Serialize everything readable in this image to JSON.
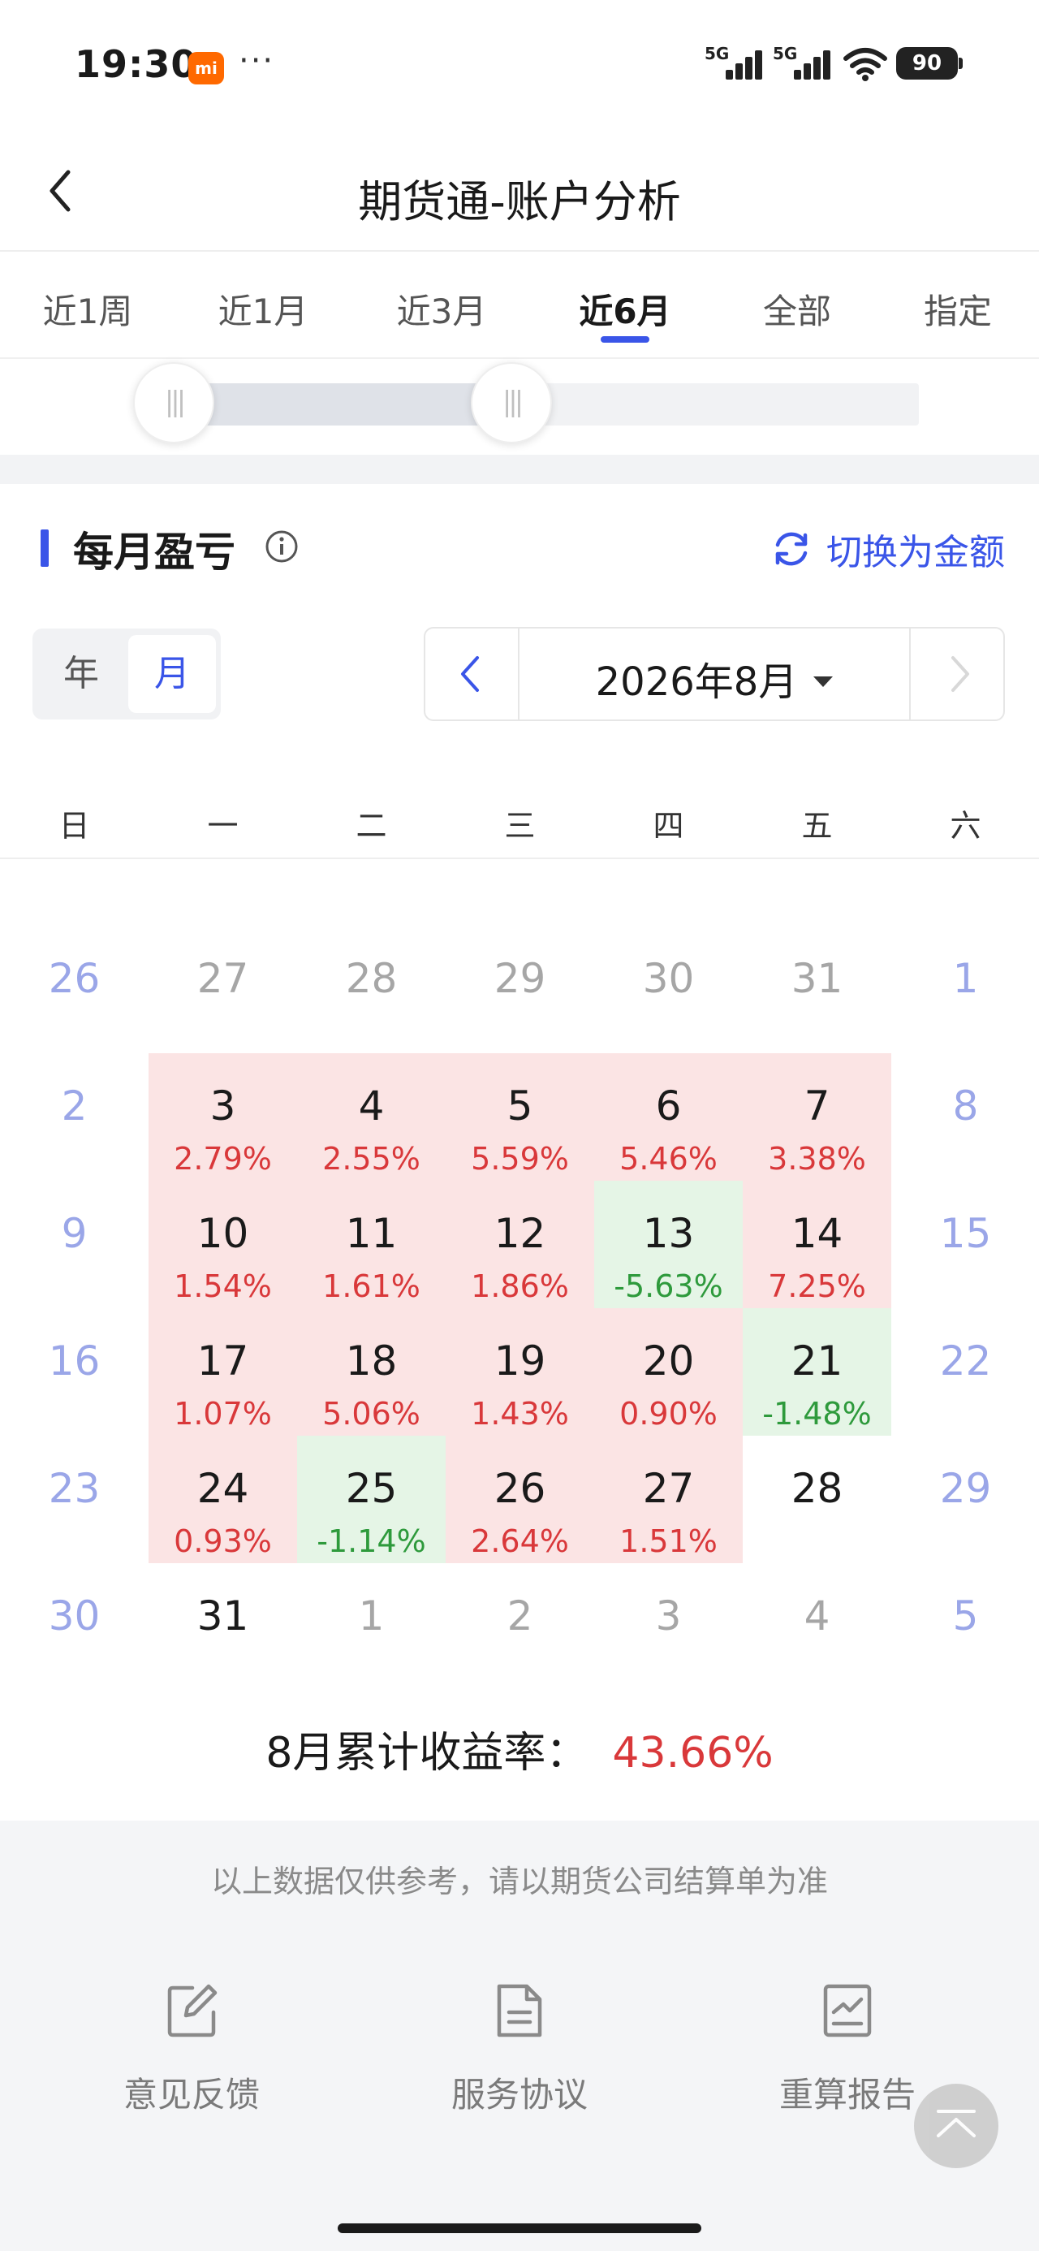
{
  "status_bar": {
    "time": "19:30",
    "mi_badge": "mi",
    "dots": "···",
    "signal1": "5G",
    "signal2": "5G",
    "battery": "90"
  },
  "header": {
    "title": "期货通-账户分析"
  },
  "tabs": [
    {
      "label": "近1周"
    },
    {
      "label": "近1月"
    },
    {
      "label": "近3月"
    },
    {
      "label": "近6月"
    },
    {
      "label": "全部"
    },
    {
      "label": "指定"
    }
  ],
  "active_tab": "近6月",
  "section": {
    "title": "每月盈亏",
    "switch_label": "切换为金额"
  },
  "period_toggle": {
    "year": "年",
    "month": "月",
    "selected": "月"
  },
  "month_picker": {
    "label": "2026年8月"
  },
  "weekdays": [
    "日",
    "一",
    "二",
    "三",
    "四",
    "五",
    "六"
  ],
  "calendar": {
    "weeks": [
      [
        {
          "d": "26"
        },
        {
          "d": "27"
        },
        {
          "d": "28"
        },
        {
          "d": "29"
        },
        {
          "d": "30"
        },
        {
          "d": "31"
        },
        {
          "d": "1"
        }
      ],
      [
        {
          "d": "2"
        },
        {
          "d": "3",
          "p": "2.79%"
        },
        {
          "d": "4",
          "p": "2.55%"
        },
        {
          "d": "5",
          "p": "5.59%"
        },
        {
          "d": "6",
          "p": "5.46%"
        },
        {
          "d": "7",
          "p": "3.38%"
        },
        {
          "d": "8"
        }
      ],
      [
        {
          "d": "9"
        },
        {
          "d": "10",
          "p": "1.54%"
        },
        {
          "d": "11",
          "p": "1.61%"
        },
        {
          "d": "12",
          "p": "1.86%"
        },
        {
          "d": "13",
          "p": "-5.63%"
        },
        {
          "d": "14",
          "p": "7.25%"
        },
        {
          "d": "15"
        }
      ],
      [
        {
          "d": "16"
        },
        {
          "d": "17",
          "p": "1.07%"
        },
        {
          "d": "18",
          "p": "5.06%"
        },
        {
          "d": "19",
          "p": "1.43%"
        },
        {
          "d": "20",
          "p": "0.90%"
        },
        {
          "d": "21",
          "p": "-1.48%"
        },
        {
          "d": "22"
        }
      ],
      [
        {
          "d": "23"
        },
        {
          "d": "24",
          "p": "0.93%"
        },
        {
          "d": "25",
          "p": "-1.14%"
        },
        {
          "d": "26",
          "p": "2.64%"
        },
        {
          "d": "27",
          "p": "1.51%"
        },
        {
          "d": "28"
        },
        {
          "d": "29"
        }
      ],
      [
        {
          "d": "30"
        },
        {
          "d": "31"
        },
        {
          "d": "1"
        },
        {
          "d": "2"
        },
        {
          "d": "3"
        },
        {
          "d": "4"
        },
        {
          "d": "5"
        }
      ]
    ]
  },
  "cumulative": {
    "label": "8月累计收益率：",
    "value": "43.66%"
  },
  "footer": {
    "disclaimer": "以上数据仅供参考，请以期货公司结算单为准",
    "items": [
      {
        "label": "意见反馈"
      },
      {
        "label": "服务协议"
      },
      {
        "label": "重算报告"
      }
    ]
  },
  "colors": {
    "accent": "#3a55e8",
    "profit": "#d9383a",
    "loss": "#2e9a3c",
    "profit_bg": "#fbe4e4",
    "loss_bg": "#e5f5e6"
  },
  "icons": [
    "back-arrow-icon",
    "info-icon",
    "refresh-icon",
    "chevron-left-icon",
    "chevron-right-icon",
    "caret-down-icon",
    "edit-icon",
    "document-icon",
    "chart-report-icon",
    "scroll-top-icon"
  ]
}
